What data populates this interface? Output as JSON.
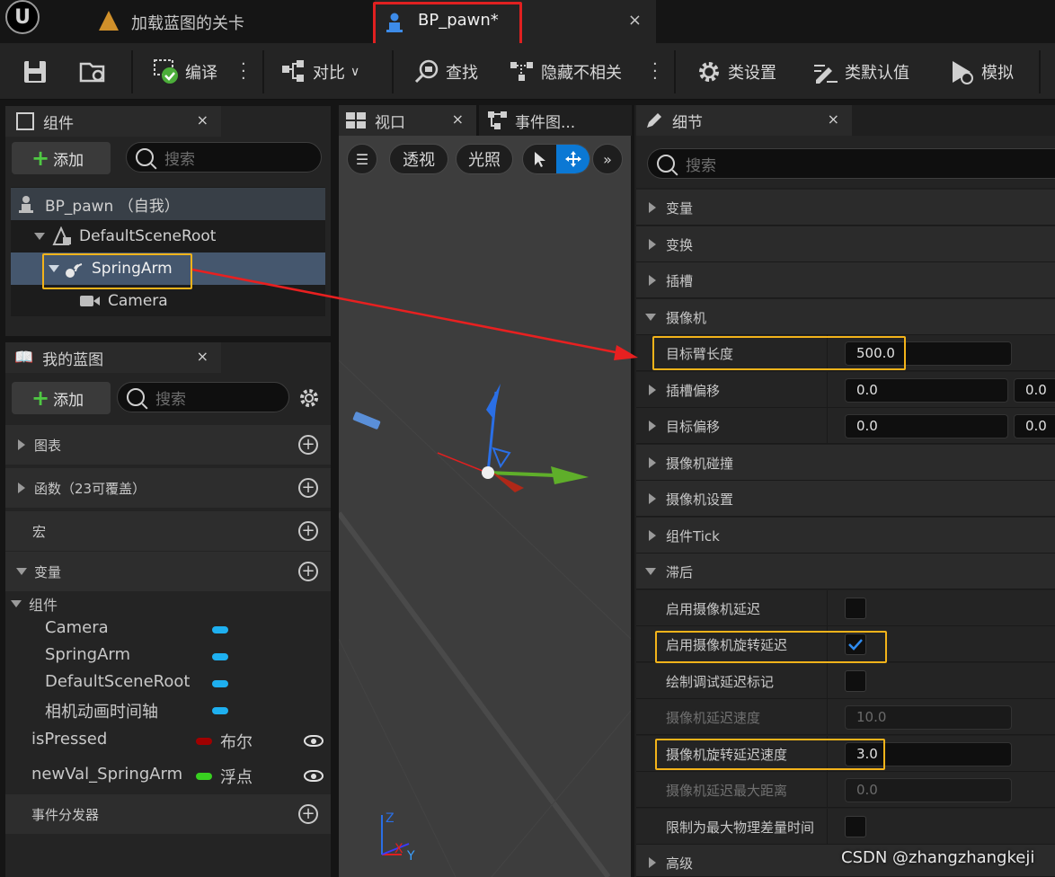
{
  "tabs": {
    "level_tab": "加载蓝图的关卡",
    "bp_tab": "BP_pawn*",
    "close": "×"
  },
  "toolbar": {
    "compile": "编译",
    "diff": "对比",
    "find": "查找",
    "hide_unrelated": "隐藏不相关",
    "class_settings": "类设置",
    "class_defaults": "类默认值",
    "simulate": "模拟"
  },
  "components_panel": {
    "title": "组件",
    "add": "添加",
    "search_placeholder": "搜索",
    "tree": [
      {
        "label": "BP_pawn （自我）",
        "level": 0
      },
      {
        "label": "DefaultSceneRoot",
        "level": 1
      },
      {
        "label": "SpringArm",
        "level": 2,
        "selected": true
      },
      {
        "label": "Camera",
        "level": 3
      }
    ]
  },
  "blueprint_panel": {
    "title": "我的蓝图",
    "add": "添加",
    "search_placeholder": "搜索",
    "sections": {
      "graphs": "图表",
      "functions": "函数（23可覆盖）",
      "macros": "宏",
      "variables": "变量",
      "components": "组件",
      "dispatchers": "事件分发器"
    },
    "component_vars": [
      "Camera",
      "SpringArm",
      "DefaultSceneRoot",
      "相机动画时间轴"
    ],
    "variables": [
      {
        "name": "isPressed",
        "type": "布尔",
        "color": "#a00000"
      },
      {
        "name": "newVal_SpringArm",
        "type": "浮点",
        "color": "#38d020"
      }
    ]
  },
  "viewport_panel": {
    "tab_viewport": "视口",
    "tab_event": "事件图...",
    "perspective": "透视",
    "lighting": "光照",
    "axis_labels": {
      "z": "Z",
      "x": "X",
      "y": "Y"
    }
  },
  "details_panel": {
    "title": "细节",
    "search_placeholder": "搜索",
    "rows": {
      "variables": "变量",
      "transform": "变换",
      "sockets": "插槽",
      "camera": "摄像机",
      "target_arm_length": "目标臂长度",
      "target_arm_length_val": "500.0",
      "socket_offset": "插槽偏移",
      "socket_offset_x": "0.0",
      "socket_offset_y": "0.0",
      "target_offset": "目标偏移",
      "target_offset_x": "0.0",
      "target_offset_y": "0.0",
      "camera_collision": "摄像机碰撞",
      "camera_settings": "摄像机设置",
      "component_tick": "组件Tick",
      "lag": "滞后",
      "enable_camera_lag": "启用摄像机延迟",
      "enable_camera_rotation_lag": "启用摄像机旋转延迟",
      "draw_debug_lag_markers": "绘制调试延迟标记",
      "camera_lag_speed": "摄像机延迟速度",
      "camera_lag_speed_val": "10.0",
      "camera_rotation_lag_speed": "摄像机旋转延迟速度",
      "camera_rotation_lag_speed_val": "3.0",
      "camera_lag_max_distance": "摄像机延迟最大距离",
      "camera_lag_max_distance_val": "0.0",
      "clamp_to_max_physics_delta": "限制为最大物理差量时间",
      "advanced": "高级"
    }
  },
  "watermark": "CSDN @zhangzhangkeji",
  "colors": {
    "accent": "#0b78d4",
    "highlight_box": "#f3b31a",
    "annotation": "#e02020"
  }
}
